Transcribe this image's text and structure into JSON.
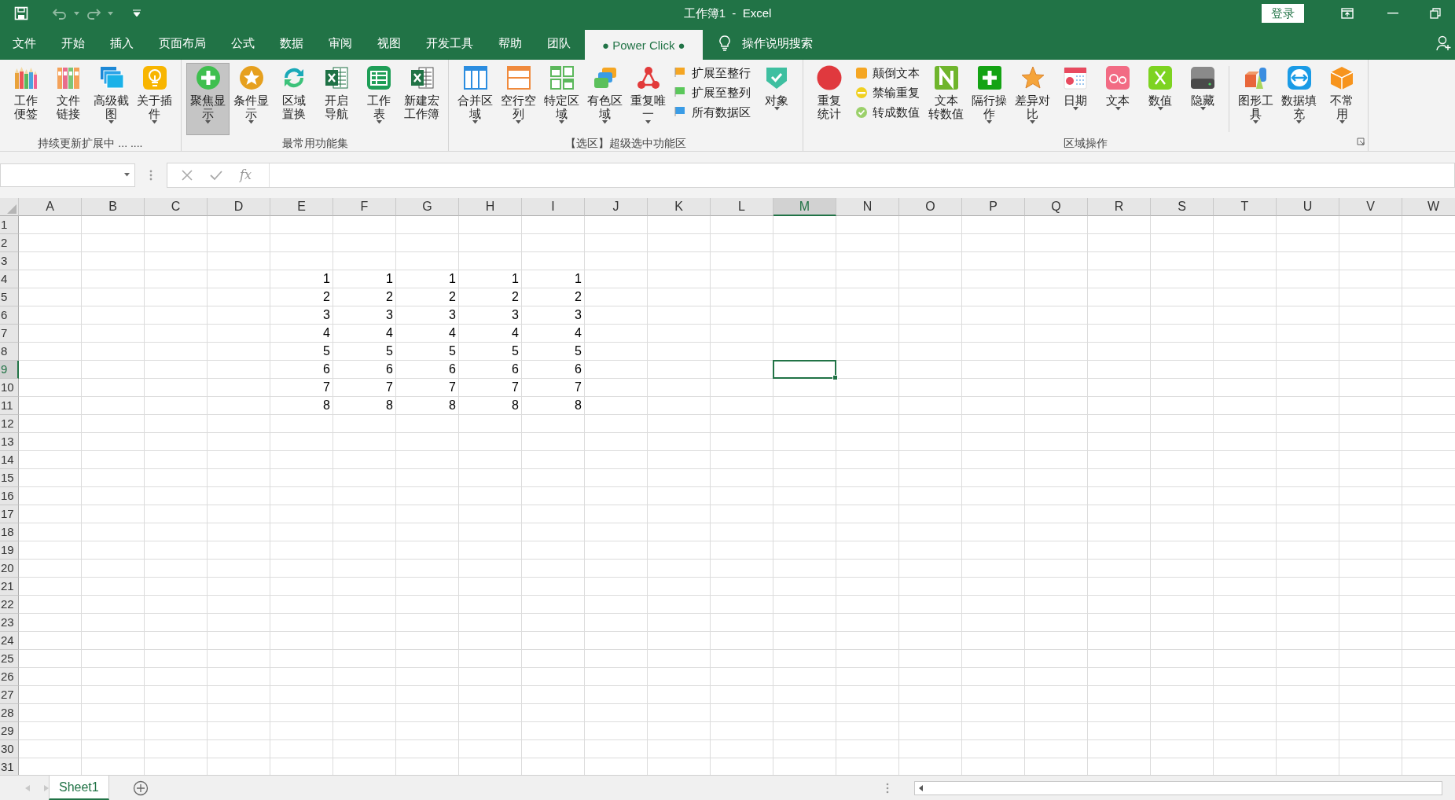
{
  "title_bar": {
    "title": "工作簿1  -  Excel",
    "sign_in": "登录"
  },
  "ribbon_tabs": [
    {
      "label": "文件",
      "selected": false
    },
    {
      "label": "开始",
      "selected": false
    },
    {
      "label": "插入",
      "selected": false
    },
    {
      "label": "页面布局",
      "selected": false
    },
    {
      "label": "公式",
      "selected": false
    },
    {
      "label": "数据",
      "selected": false
    },
    {
      "label": "审阅",
      "selected": false
    },
    {
      "label": "视图",
      "selected": false
    },
    {
      "label": "开发工具",
      "selected": false
    },
    {
      "label": "帮助",
      "selected": false
    },
    {
      "label": "团队",
      "selected": false
    },
    {
      "label": "● Power Click ●",
      "selected": true
    }
  ],
  "tell_me": {
    "placeholder": "操作说明搜索"
  },
  "ribbon_groups": [
    {
      "label": "持续更新扩展中 ... ....",
      "launcher": false,
      "items": [
        {
          "kind": "large",
          "lines": [
            "工作",
            "便签"
          ],
          "dropdown": false,
          "pressed": false
        },
        {
          "kind": "large",
          "lines": [
            "文件",
            "链接"
          ],
          "dropdown": false,
          "pressed": false
        },
        {
          "kind": "large",
          "lines": [
            "高级截",
            "图"
          ],
          "dropdown": true,
          "pressed": false
        },
        {
          "kind": "large",
          "lines": [
            "关于插",
            "件"
          ],
          "dropdown": true,
          "pressed": false
        }
      ]
    },
    {
      "label": "最常用功能集",
      "launcher": false,
      "items": [
        {
          "kind": "large",
          "lines": [
            "聚焦显",
            "示"
          ],
          "dropdown": true,
          "pressed": true
        },
        {
          "kind": "large",
          "lines": [
            "条件显",
            "示"
          ],
          "dropdown": true,
          "pressed": false
        },
        {
          "kind": "large",
          "lines": [
            "区域",
            "置换"
          ],
          "dropdown": false,
          "pressed": false
        },
        {
          "kind": "large",
          "lines": [
            "开启",
            "导航"
          ],
          "dropdown": false,
          "pressed": false
        },
        {
          "kind": "large",
          "lines": [
            "工作",
            "表"
          ],
          "dropdown": true,
          "pressed": false
        },
        {
          "kind": "large",
          "lines": [
            "新建宏",
            "工作簿"
          ],
          "dropdown": false,
          "pressed": false
        }
      ]
    },
    {
      "label": "【选区】超级选中功能区",
      "launcher": false,
      "items": [
        {
          "kind": "large",
          "lines": [
            "合并区",
            "域"
          ],
          "dropdown": true,
          "pressed": false
        },
        {
          "kind": "large",
          "lines": [
            "空行空",
            "列"
          ],
          "dropdown": true,
          "pressed": false
        },
        {
          "kind": "large",
          "lines": [
            "特定区",
            "域"
          ],
          "dropdown": true,
          "pressed": false
        },
        {
          "kind": "large",
          "lines": [
            "有色区",
            "域"
          ],
          "dropdown": true,
          "pressed": false
        },
        {
          "kind": "large",
          "lines": [
            "重复唯",
            "一"
          ],
          "dropdown": true,
          "pressed": false
        },
        {
          "kind": "stack",
          "entries": [
            "扩展至整行",
            "扩展至整列",
            "所有数据区"
          ]
        },
        {
          "kind": "large",
          "lines": [
            "对象"
          ],
          "dropdown": true,
          "pressed": false
        }
      ]
    },
    {
      "label": "区域操作",
      "launcher": true,
      "items": [
        {
          "kind": "large",
          "lines": [
            "重复",
            "统计"
          ],
          "dropdown": false,
          "pressed": false
        },
        {
          "kind": "stack",
          "entries": [
            "颠倒文本",
            "禁输重复",
            "转成数值"
          ]
        },
        {
          "kind": "large",
          "lines": [
            "文本",
            "转数值"
          ],
          "dropdown": false,
          "pressed": false
        },
        {
          "kind": "large",
          "lines": [
            "隔行操",
            "作"
          ],
          "dropdown": true,
          "pressed": false
        },
        {
          "kind": "large",
          "lines": [
            "差异对",
            "比"
          ],
          "dropdown": true,
          "pressed": false
        },
        {
          "kind": "large",
          "lines": [
            "日期"
          ],
          "dropdown": true,
          "pressed": false
        },
        {
          "kind": "large",
          "lines": [
            "文本"
          ],
          "dropdown": true,
          "pressed": false
        },
        {
          "kind": "large",
          "lines": [
            "数值"
          ],
          "dropdown": true,
          "pressed": false
        },
        {
          "kind": "large",
          "lines": [
            "隐藏"
          ],
          "dropdown": true,
          "pressed": false
        },
        {
          "kind": "separator"
        },
        {
          "kind": "large",
          "lines": [
            "图形工",
            "具"
          ],
          "dropdown": true,
          "pressed": false
        },
        {
          "kind": "large",
          "lines": [
            "数据填",
            "充"
          ],
          "dropdown": true,
          "pressed": false
        },
        {
          "kind": "large",
          "lines": [
            "不常",
            "用"
          ],
          "dropdown": true,
          "pressed": false
        }
      ]
    }
  ],
  "formula_bar": {
    "insert_function": "fx"
  },
  "columns": [
    {
      "label": "A",
      "selected": false
    },
    {
      "label": "B",
      "selected": false
    },
    {
      "label": "C",
      "selected": false
    },
    {
      "label": "D",
      "selected": false
    },
    {
      "label": "E",
      "selected": false
    },
    {
      "label": "F",
      "selected": false
    },
    {
      "label": "G",
      "selected": false
    },
    {
      "label": "H",
      "selected": false
    },
    {
      "label": "I",
      "selected": false
    },
    {
      "label": "J",
      "selected": false
    },
    {
      "label": "K",
      "selected": false
    },
    {
      "label": "L",
      "selected": false
    },
    {
      "label": "M",
      "selected": true
    },
    {
      "label": "N",
      "selected": false
    },
    {
      "label": "O",
      "selected": false
    },
    {
      "label": "P",
      "selected": false
    },
    {
      "label": "Q",
      "selected": false
    },
    {
      "label": "R",
      "selected": false
    },
    {
      "label": "S",
      "selected": false
    },
    {
      "label": "T",
      "selected": false
    },
    {
      "label": "U",
      "selected": false
    },
    {
      "label": "V",
      "selected": false
    },
    {
      "label": "W",
      "selected": false
    }
  ],
  "rows": [
    {
      "label": "1",
      "selected": false
    },
    {
      "label": "2",
      "selected": false
    },
    {
      "label": "3",
      "selected": false
    },
    {
      "label": "4",
      "selected": false,
      "cells": [
        null,
        null,
        null,
        null,
        "1",
        "1",
        "1",
        "1",
        "1"
      ]
    },
    {
      "label": "5",
      "selected": false,
      "cells": [
        null,
        null,
        null,
        null,
        "2",
        "2",
        "2",
        "2",
        "2"
      ]
    },
    {
      "label": "6",
      "selected": false,
      "cells": [
        null,
        null,
        null,
        null,
        "3",
        "3",
        "3",
        "3",
        "3"
      ]
    },
    {
      "label": "7",
      "selected": false,
      "cells": [
        null,
        null,
        null,
        null,
        "4",
        "4",
        "4",
        "4",
        "4"
      ]
    },
    {
      "label": "8",
      "selected": false,
      "cells": [
        null,
        null,
        null,
        null,
        "5",
        "5",
        "5",
        "5",
        "5"
      ]
    },
    {
      "label": "9",
      "selected": true,
      "cells": [
        null,
        null,
        null,
        null,
        "6",
        "6",
        "6",
        "6",
        "6"
      ]
    },
    {
      "label": "10",
      "selected": false,
      "cells": [
        null,
        null,
        null,
        null,
        "7",
        "7",
        "7",
        "7",
        "7"
      ]
    },
    {
      "label": "11",
      "selected": false,
      "cells": [
        null,
        null,
        null,
        null,
        "8",
        "8",
        "8",
        "8",
        "8"
      ]
    },
    {
      "label": "12",
      "selected": false
    },
    {
      "label": "13",
      "selected": false
    },
    {
      "label": "14",
      "selected": false
    },
    {
      "label": "15",
      "selected": false
    },
    {
      "label": "16",
      "selected": false
    },
    {
      "label": "17",
      "selected": false
    },
    {
      "label": "18",
      "selected": false
    },
    {
      "label": "19",
      "selected": false
    },
    {
      "label": "20",
      "selected": false
    },
    {
      "label": "21",
      "selected": false
    },
    {
      "label": "22",
      "selected": false
    },
    {
      "label": "23",
      "selected": false
    },
    {
      "label": "24",
      "selected": false
    },
    {
      "label": "25",
      "selected": false
    },
    {
      "label": "26",
      "selected": false
    },
    {
      "label": "27",
      "selected": false
    },
    {
      "label": "28",
      "selected": false
    },
    {
      "label": "29",
      "selected": false
    },
    {
      "label": "30",
      "selected": false
    },
    {
      "label": "31",
      "selected": false
    }
  ],
  "sheet_tabs": [
    {
      "label": "Sheet1",
      "selected": true
    }
  ]
}
